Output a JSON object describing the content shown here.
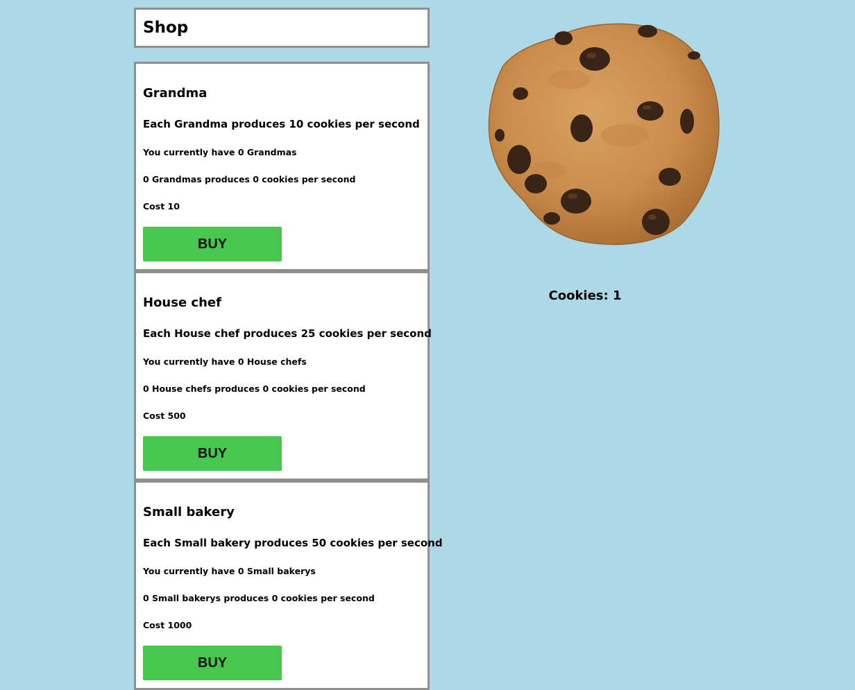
{
  "shop": {
    "title": "Shop",
    "items": [
      {
        "name": "Grandma",
        "rate_text": "Each Grandma produces 10 cookies per second",
        "owned_text": "You currently have 0 Grandmas",
        "total_text": "0 Grandmas produces 0 cookies per second",
        "cost_text": "Cost 10",
        "buy_label": "BUY"
      },
      {
        "name": "House chef",
        "rate_text": "Each House chef produces 25 cookies per second",
        "owned_text": "You currently have 0 House chefs",
        "total_text": "0 House chefs produces 0 cookies per second",
        "cost_text": "Cost 500",
        "buy_label": "BUY"
      },
      {
        "name": "Small bakery",
        "rate_text": "Each Small bakery produces 50 cookies per second",
        "owned_text": "You currently have 0 Small bakerys",
        "total_text": "0 Small bakerys produces 0 cookies per second",
        "cost_text": "Cost 1000",
        "buy_label": "BUY"
      }
    ]
  },
  "cookie": {
    "icon": "cookie-icon",
    "counter_text": "Cookies: 1"
  },
  "colors": {
    "background": "#add8e6",
    "buy_button": "#48c74f",
    "panel_border": "#8f8f8f",
    "cookie_dough": "#c98c4b",
    "chocolate_chip": "#3a2418"
  }
}
